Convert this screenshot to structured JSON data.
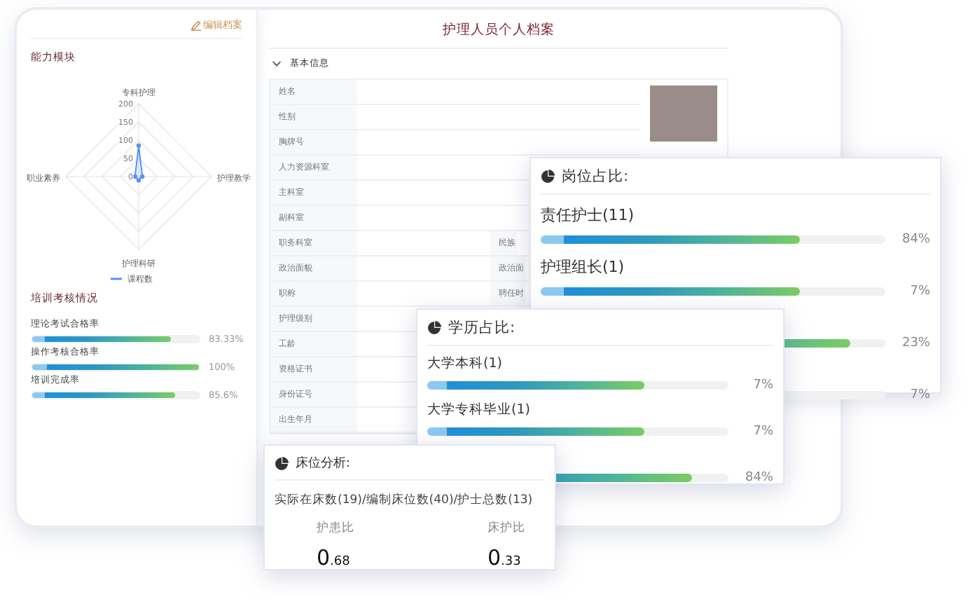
{
  "edit_link": "编辑档案",
  "ability": {
    "title": "能力模块",
    "chart_data": {
      "type": "radar",
      "categories": [
        "专科护理",
        "护理教学",
        "护理科研",
        "职业素养"
      ],
      "series": [
        {
          "name": "课程数",
          "color": "#5b8ff9",
          "values": [
            85,
            10,
            10,
            10
          ]
        }
      ],
      "ylim": [
        0,
        200
      ],
      "yticks": [
        0,
        50,
        100,
        150,
        200
      ]
    }
  },
  "training": {
    "title": "培训考核情况",
    "items": [
      {
        "label": "理论考试合格率",
        "level": 0.8333,
        "reading": "83.33%"
      },
      {
        "label": "操作考核合格率",
        "level": 1,
        "reading": "100%"
      },
      {
        "label": "培训完成率",
        "level": 0.856,
        "reading": "85.6%"
      }
    ]
  },
  "profile": {
    "title": "护理人员个人档案",
    "section": {
      "title": "基本信息",
      "expanded": true
    },
    "top_fields": [
      "姓名",
      "性别",
      "胸牌号",
      "人力资源科室",
      "主科室",
      "副科室"
    ],
    "fields": [
      {
        "label": "职务科室",
        "side": "民族"
      },
      {
        "label": "政治面貌",
        "side": "政治面"
      },
      {
        "label": "职称",
        "side": "聘任时"
      },
      {
        "label": "护理级别"
      },
      {
        "label": "工龄"
      },
      {
        "label": "资格证书"
      },
      {
        "label": "身份证号"
      },
      {
        "label": "出生年月"
      }
    ]
  },
  "post_card": {
    "title": "岗位占比:",
    "rows": [
      {
        "label": "责任护士(11)",
        "level": 0.75,
        "reading": "84%"
      },
      {
        "label": "护理组长(1)",
        "level": 0.75,
        "reading": "7%"
      },
      {
        "level": 0.9,
        "reading": "23%"
      },
      {
        "reading": "7%"
      }
    ]
  },
  "edu_card": {
    "title": "学历占比:",
    "rows": [
      {
        "label": "大学本科(1)",
        "level": 0.72,
        "reading": "7%"
      },
      {
        "label": "大学专科毕业(1)",
        "level": 0.72,
        "reading": "7%"
      },
      {
        "level": 0.88,
        "reading": "84%"
      }
    ]
  },
  "bed_card": {
    "title": "床位分析:",
    "summary": "实际在床数(19)/编制床位数(40)/护士总数(13)",
    "stats": [
      {
        "label": "护患比",
        "whole": "0",
        "fraction": ".68"
      },
      {
        "label": "床护比",
        "whole": "0",
        "fraction": ".33"
      }
    ]
  }
}
